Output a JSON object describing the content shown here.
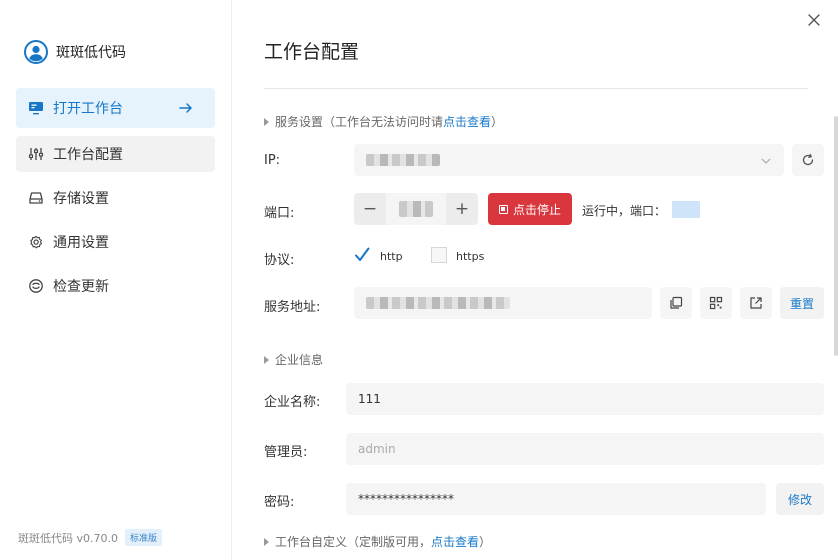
{
  "app": {
    "brand_name": "斑斑低代码",
    "version": "斑斑低代码 v0.70.0",
    "edition_badge": "标准版"
  },
  "sidebar": {
    "items": [
      {
        "label": "打开工作台",
        "icon": "monitor-icon",
        "state": "active"
      },
      {
        "label": "工作台配置",
        "icon": "sliders-icon",
        "state": "hover"
      },
      {
        "label": "存储设置",
        "icon": "storage-icon",
        "state": "normal"
      },
      {
        "label": "通用设置",
        "icon": "gear-icon",
        "state": "normal"
      },
      {
        "label": "检查更新",
        "icon": "refresh-smile-icon",
        "state": "normal"
      }
    ]
  },
  "main": {
    "title": "工作台配置",
    "service_section": {
      "title": "服务设置",
      "hint_prefix": "（工作台无法访问时请",
      "hint_link": "点击查看",
      "hint_suffix": "）"
    },
    "ip": {
      "label": "IP:",
      "value_hidden": true
    },
    "port": {
      "label": "端口:",
      "decrement": "−",
      "increment": "+",
      "stop_label": "点击停止",
      "status_text": "运行中，端口："
    },
    "protocol": {
      "label": "协议:",
      "options": [
        {
          "label": "http",
          "checked": true
        },
        {
          "label": "https",
          "checked": false
        }
      ]
    },
    "service_address": {
      "label": "服务地址:",
      "reset_label": "重置"
    },
    "company_section": {
      "title": "企业信息"
    },
    "company_name": {
      "label": "企业名称:",
      "value": "111"
    },
    "admin": {
      "label": "管理员:",
      "placeholder": "admin"
    },
    "password": {
      "label": "密码:",
      "value": "****************",
      "modify_label": "修改"
    },
    "custom_section": {
      "title": "工作台自定义",
      "hint_prefix": "（定制版可用，",
      "hint_link": "点击查看",
      "hint_suffix": "）"
    }
  },
  "colors": {
    "accent": "#1a7ac8",
    "danger": "#d9363e",
    "active_bg": "#e6f2fc"
  }
}
